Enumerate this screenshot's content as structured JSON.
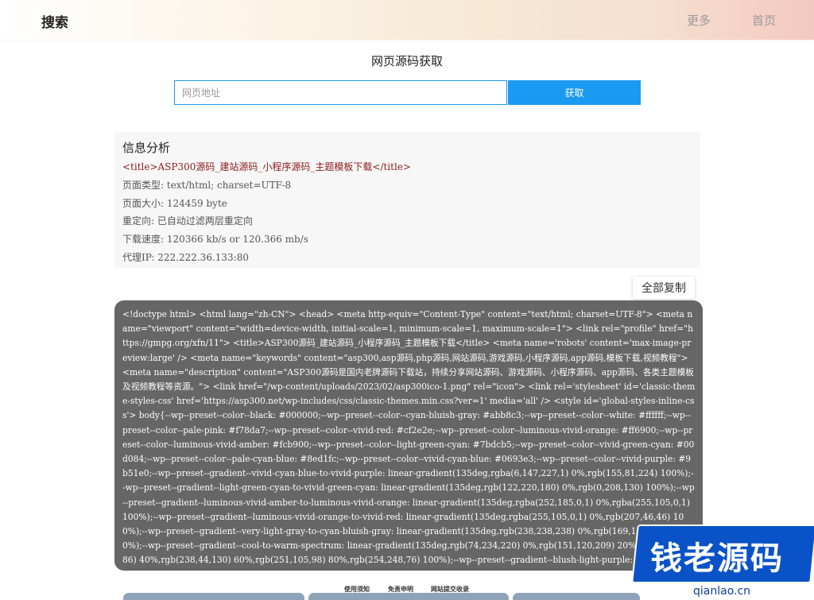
{
  "header": {
    "logo": "搜索",
    "nav": {
      "more": "更多",
      "home": "首页"
    }
  },
  "main": {
    "title": "网页源码获取",
    "url_placeholder": "网页地址",
    "fetch_label": "获取"
  },
  "info": {
    "heading": "信息分析",
    "title_tag": "<title>ASP300源码_建站源码_小程序源码_主题模板下载</title>",
    "content_type": "页面类型: text/html; charset=UTF-8",
    "page_size": "页面大小: 124459 byte",
    "redirect": "重定向: 已自动过滤两层重定向",
    "speed": "下载速度: 120366 kb/s or 120.366 mb/s",
    "proxy_ip": "代理IP: 222.222.36.133:80"
  },
  "copy_all_label": "全部复制",
  "source_code": "<!doctype html> <html lang=\"zh-CN\"> <head> <meta http-equiv=\"Content-Type\" content=\"text/html; charset=UTF-8\"> <meta name=\"viewport\" content=\"width=device-width, initial-scale=1, minimum-scale=1, maximum-scale=1\"> <link rel=\"profile\" href=\"https://gmpg.org/xfn/11\"> <title>ASP300源码_建站源码_小程序源码_主题模板下载</title> <meta name='robots' content='max-image-preview:large' /> <meta name=\"keywords\" content=\"asp300,asp源码,php源码,网站源码,游戏源码,小程序源码,app源码,模板下载,视频教程\"> <meta name=\"description\" content=\"ASP300源码是国内老牌源码下载站，持续分享网站源码、游戏源码、小程序源码、app源码、各类主题模板及视频教程等资源。\"> <link href=\"/wp-content/uploads/2023/02/asp300ico-1.png\" rel=\"icon\"> <link rel='stylesheet' id='classic-theme-styles-css' href='https://asp300.net/wp-includes/css/classic-themes.min.css?ver=1' media='all' /> <style id='global-styles-inline-css'> body{--wp--preset--color--black: #000000;--wp--preset--color--cyan-bluish-gray: #abb8c3;--wp--preset--color--white: #ffffff;--wp--preset--color--pale-pink: #f78da7;--wp--preset--color--vivid-red: #cf2e2e;--wp--preset--color--luminous-vivid-orange: #ff6900;--wp--preset--color--luminous-vivid-amber: #fcb900;--wp--preset--color--light-green-cyan: #7bdcb5;--wp--preset--color--vivid-green-cyan: #00d084;--wp--preset--color--pale-cyan-blue: #8ed1fc;--wp--preset--color--vivid-cyan-blue: #0693e3;--wp--preset--color--vivid-purple: #9b51e0;--wp--preset--gradient--vivid-cyan-blue-to-vivid-purple: linear-gradient(135deg,rgba(6,147,227,1) 0%,rgb(155,81,224) 100%);--wp--preset--gradient--light-green-cyan-to-vivid-green-cyan: linear-gradient(135deg,rgb(122,220,180) 0%,rgb(0,208,130) 100%);--wp--preset--gradient--luminous-vivid-amber-to-luminous-vivid-orange: linear-gradient(135deg,rgba(252,185,0,1) 0%,rgba(255,105,0,1) 100%);--wp--preset--gradient--luminous-vivid-orange-to-vivid-red: linear-gradient(135deg,rgba(255,105,0,1) 0%,rgb(207,46,46) 100%);--wp--preset--gradient--very-light-gray-to-cyan-bluish-gray: linear-gradient(135deg,rgb(238,238,238) 0%,rgb(169,184,195) 100%);--wp--preset--gradient--cool-to-warm-spectrum: linear-gradient(135deg,rgb(74,234,220) 0%,rgb(151,120,209) 20%,rgb(207,42,186) 40%,rgb(238,44,130) 60%,rgb(251,105,98) 80%,rgb(254,248,76) 100%);--wp--preset--gradient--blush-light-purple: linear-gradient(135deg,rgb(255,206,236) 0%,rgb(152,150,240) 100%);--wp--preset--gradient--blush-bordeaux: linear-gradient(135deg,rgb(254,205,165) 0%,rgb(254,45,45) 50%,rgb(107,0,62) 100%);--wp--preset--gradient--luminous-dusk",
  "footer": {
    "links": [
      "使用须知",
      "免责申明",
      "网站提交收录"
    ]
  },
  "watermark": {
    "text": "钱老源码",
    "url": "qianlao.cn"
  },
  "colors": {
    "accent": "#1a9af0",
    "source_bg": "#666666",
    "info_bg": "#f7f7f7",
    "title_tag_red": "#8b1a1a",
    "watermark_blue": "#0a52c7"
  }
}
